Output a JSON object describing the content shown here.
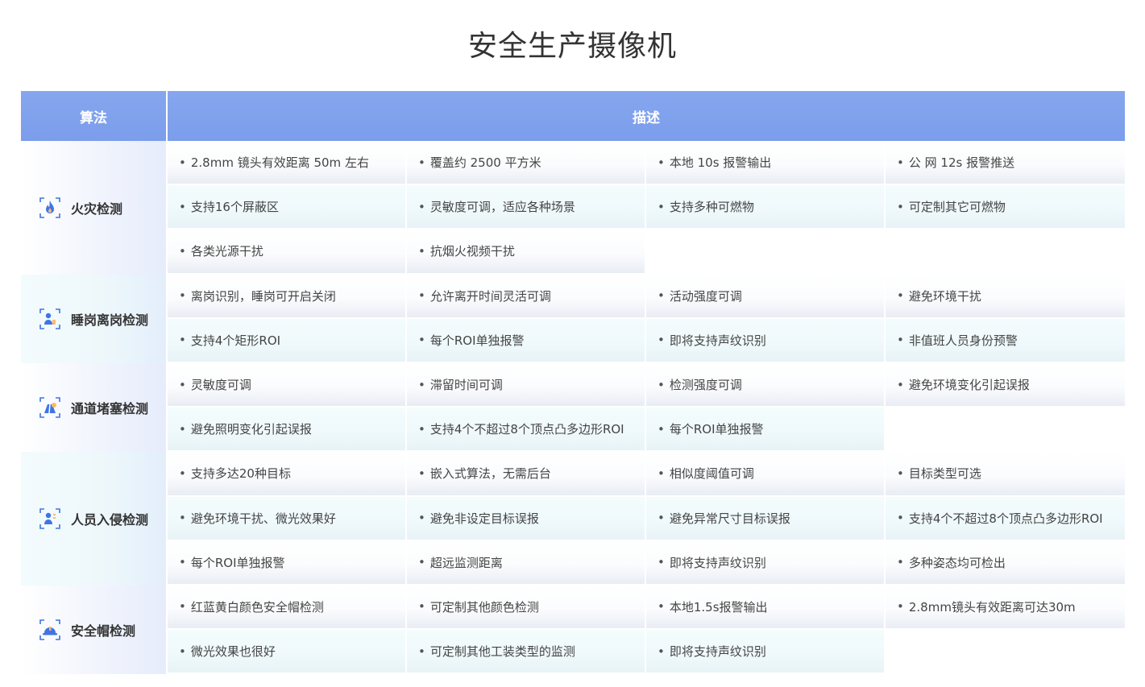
{
  "page": {
    "title": "安全生产摄像机"
  },
  "table": {
    "header": {
      "algorithm": "算法",
      "description": "描述"
    },
    "groups": [
      {
        "name": "火灾检测",
        "icon": "fire-icon",
        "rows": [
          [
            "2.8mm 镜头有效距离 50m 左右",
            "覆盖约 2500 平方米",
            "本地 10s 报警输出",
            "公 网 12s 报警推送"
          ],
          [
            "支持16个屏蔽区",
            "灵敏度可调，适应各种场景",
            "支持多种可燃物",
            "可定制其它可燃物"
          ],
          [
            "各类光源干扰",
            "抗烟火视频干扰",
            "",
            ""
          ]
        ]
      },
      {
        "name": "睡岗离岗检测",
        "icon": "person-seat-icon",
        "rows": [
          [
            "离岗识别，睡岗可开启关闭",
            "允许离开时间灵活可调",
            "活动强度可调",
            "避免环境干扰"
          ],
          [
            "支持4个矩形ROI",
            "每个ROI单独报警",
            "即将支持声纹识别",
            "非值班人员身份预警"
          ]
        ]
      },
      {
        "name": "通道堵塞检测",
        "icon": "blocked-road-icon",
        "rows": [
          [
            "灵敏度可调",
            "滞留时间可调",
            "检测强度可调",
            "避免环境变化引起误报"
          ],
          [
            "避免照明变化引起误报",
            "支持4个不超过8个顶点凸多边形ROI",
            "每个ROI单独报警",
            ""
          ]
        ]
      },
      {
        "name": "人员入侵检测",
        "icon": "intruder-icon",
        "rows": [
          [
            "支持多达20种目标",
            "嵌入式算法，无需后台",
            "相似度阈值可调",
            "目标类型可选"
          ],
          [
            "避免环境干扰、微光效果好",
            "避免非设定目标误报",
            "避免异常尺寸目标误报",
            "支持4个不超过8个顶点凸多边形ROI"
          ],
          [
            "每个ROI单独报警",
            "超远监测距离",
            "即将支持声纹识别",
            "多种姿态均可检出"
          ]
        ]
      },
      {
        "name": "安全帽检测",
        "icon": "helmet-icon",
        "rows": [
          [
            "红蓝黄白颜色安全帽检测",
            "可定制其他颜色检测",
            "本地1.5s报警输出",
            "2.8mm镜头有效距离可达30m"
          ],
          [
            "微光效果也很好",
            "可定制其他工装类型的监测",
            "即将支持声纹识别",
            ""
          ]
        ]
      }
    ]
  }
}
